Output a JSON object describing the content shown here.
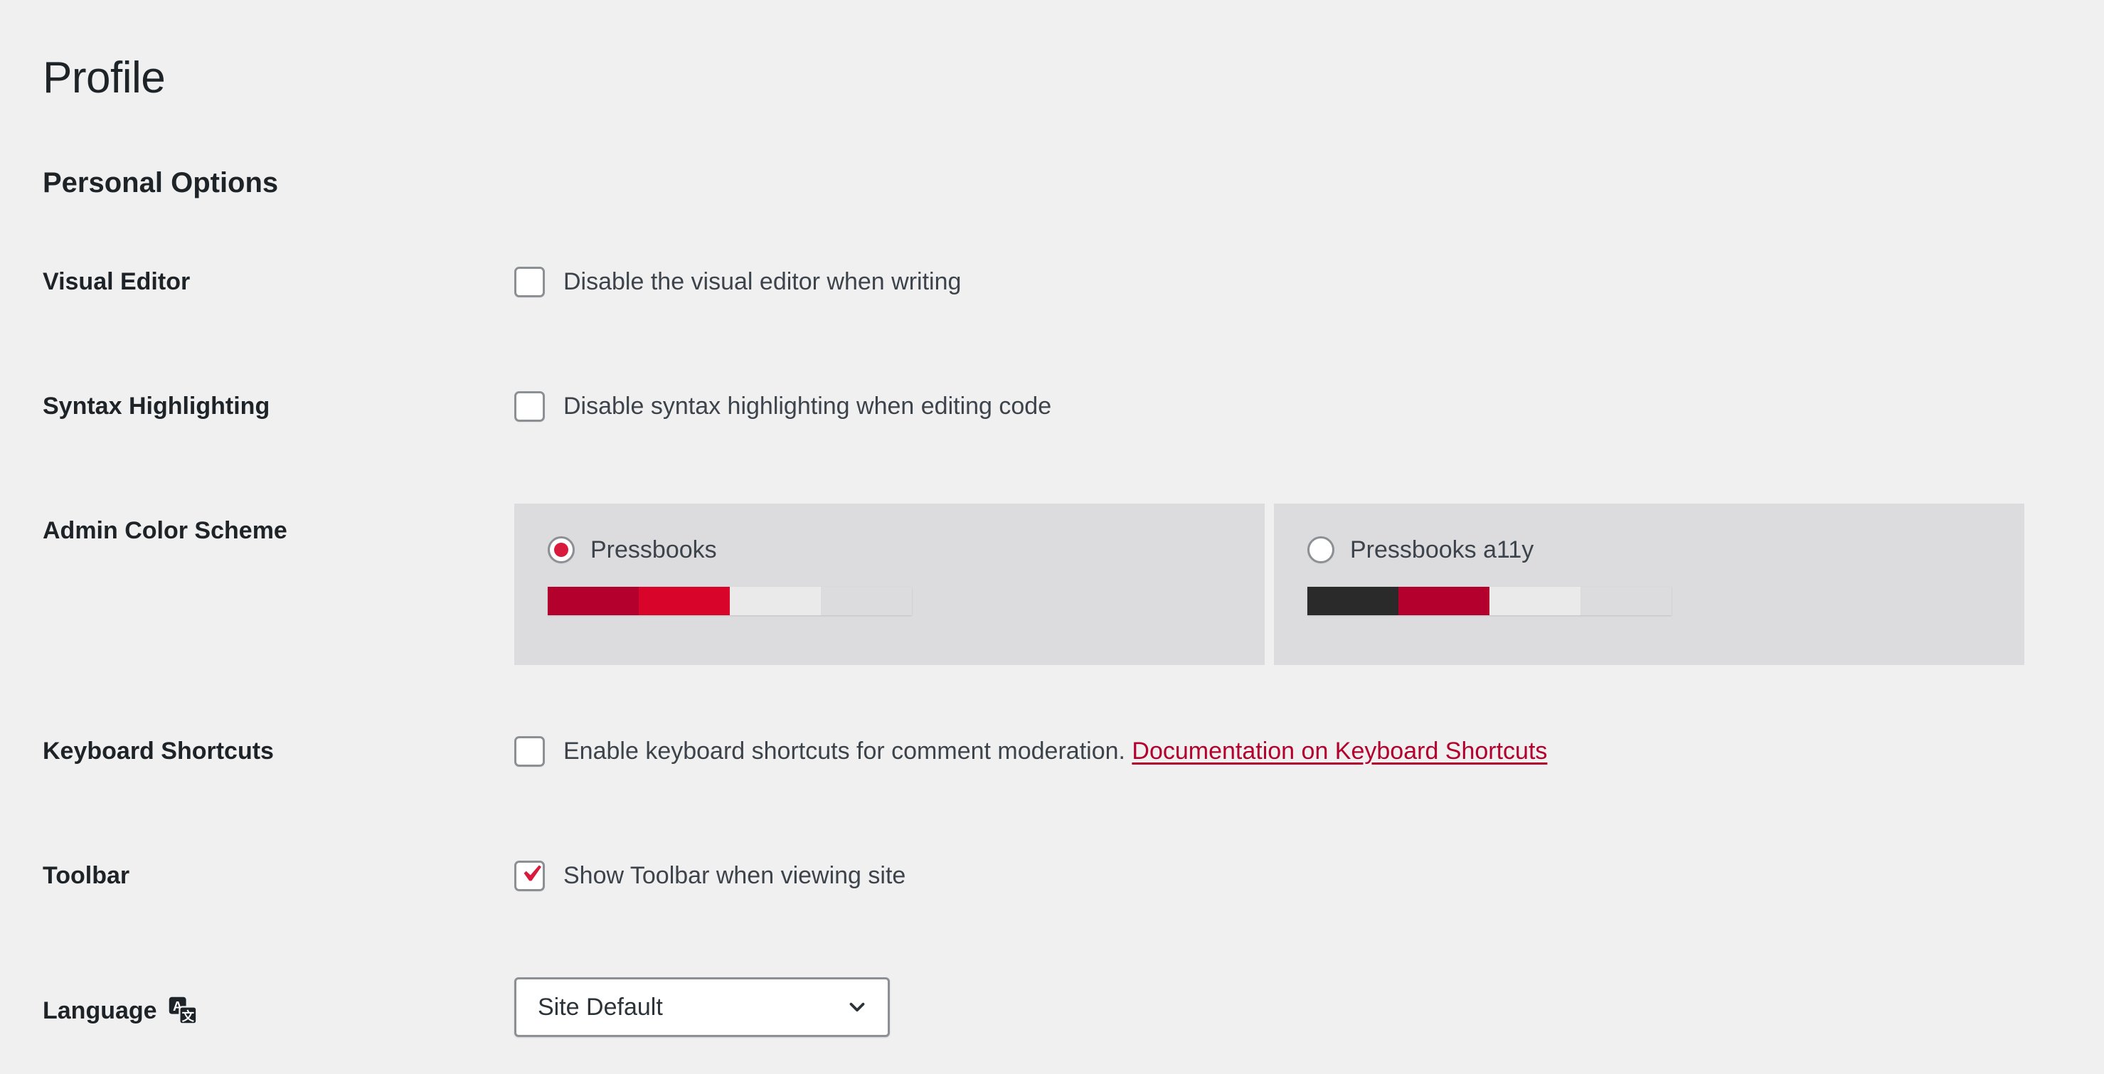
{
  "page": {
    "title": "Profile",
    "section_title": "Personal Options"
  },
  "colors": {
    "background": "#f0f0f1",
    "card_background": "#dcdcde",
    "heading": "#1d2327",
    "text": "#3c434a",
    "link": "#b3002d",
    "accent": "#d81b3d"
  },
  "rows": {
    "visual_editor": {
      "label": "Visual Editor",
      "checkbox_label": "Disable the visual editor when writing",
      "checked": false
    },
    "syntax_highlighting": {
      "label": "Syntax Highlighting",
      "checkbox_label": "Disable syntax highlighting when editing code",
      "checked": false
    },
    "admin_color_scheme": {
      "label": "Admin Color Scheme",
      "options": [
        {
          "name": "Pressbooks",
          "selected": true,
          "swatches": [
            "#b3002d",
            "#d90429",
            "#eaeaea",
            "#dcdcde"
          ]
        },
        {
          "name": "Pressbooks a11y",
          "selected": false,
          "swatches": [
            "#2a2a2a",
            "#b3002d",
            "#eaeaea",
            "#dcdcde"
          ]
        }
      ]
    },
    "keyboard_shortcuts": {
      "label": "Keyboard Shortcuts",
      "checkbox_label": "Enable keyboard shortcuts for comment moderation.",
      "link_label": "Documentation on Keyboard Shortcuts",
      "checked": false
    },
    "toolbar": {
      "label": "Toolbar",
      "checkbox_label": "Show Toolbar when viewing site",
      "checked": true
    },
    "language": {
      "label": "Language",
      "icon": "translate-icon",
      "selected_value": "Site Default",
      "dropdown_icon": "chevron-down-icon"
    }
  }
}
